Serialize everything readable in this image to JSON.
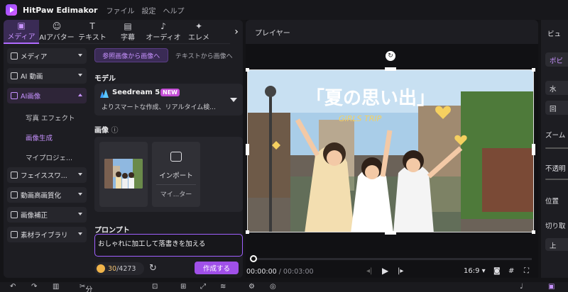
{
  "app": {
    "title": "HitPaw Edimakor",
    "menu": [
      "ファイル",
      "設定",
      "ヘルプ"
    ]
  },
  "tabs": [
    {
      "label": "メディア",
      "icon": "media-icon",
      "active": true
    },
    {
      "label": "AIアバター",
      "icon": "avatar-icon"
    },
    {
      "label": "テキスト",
      "icon": "text-icon"
    },
    {
      "label": "字幕",
      "icon": "subtitle-icon"
    },
    {
      "label": "オーディオ",
      "icon": "audio-icon"
    },
    {
      "label": "エレメ",
      "icon": "element-icon"
    }
  ],
  "sidebar": {
    "categories": [
      {
        "label": "メディア",
        "icon": "folder-icon"
      },
      {
        "label": "AI 動画",
        "icon": "ai-video-icon"
      },
      {
        "label": "AI画像",
        "icon": "ai-image-icon",
        "open": true,
        "children": [
          "写真 エフェクト",
          "画像生成",
          "マイプロジェ..."
        ],
        "active_child": 1
      },
      {
        "label": "フェイススワ...",
        "icon": "faceswap-icon"
      },
      {
        "label": "動画高画質化",
        "icon": "enhance-icon"
      },
      {
        "label": "画像補正",
        "icon": "image-fix-icon"
      },
      {
        "label": "素材ライブラリ",
        "icon": "library-icon"
      }
    ]
  },
  "panel": {
    "modes": [
      "参照画像から画像へ",
      "テキストから画像へ"
    ],
    "active_mode": 0,
    "model_label": "モデル",
    "model": {
      "name": "Seedream 5.0",
      "badge": "NEW",
      "desc": "よりスマートな作成、リアルタイム検..."
    },
    "image_label": "画像",
    "info_icon": "ⓘ",
    "import": {
      "label": "インポート",
      "sub": "マイ...ター"
    },
    "prompt_label": "プロンプト",
    "prompt_value": "おしゃれに加工して落書きを加える",
    "credits": {
      "used": "30",
      "total": "/4273"
    },
    "generate_label": "作成する"
  },
  "player": {
    "title": "プレイヤー",
    "overlay_title": "「夏の思い出」",
    "overlay_sub": "GIRLS TRIP",
    "time_current": "00:00:00",
    "time_total": " / 00:03:00",
    "ratio": "16:9",
    "progress": 0
  },
  "right_panel": {
    "items": [
      "ビュ",
      "ポビ",
      "水",
      "回",
      "ズーム",
      "不透明",
      "位置",
      "切り取",
      "上"
    ]
  },
  "toolbar": {
    "split_label": "分割"
  },
  "colors": {
    "accent": "#a050e8",
    "accent_text": "#c792ff",
    "bg": "#141417",
    "panel": "#1d1d22"
  }
}
